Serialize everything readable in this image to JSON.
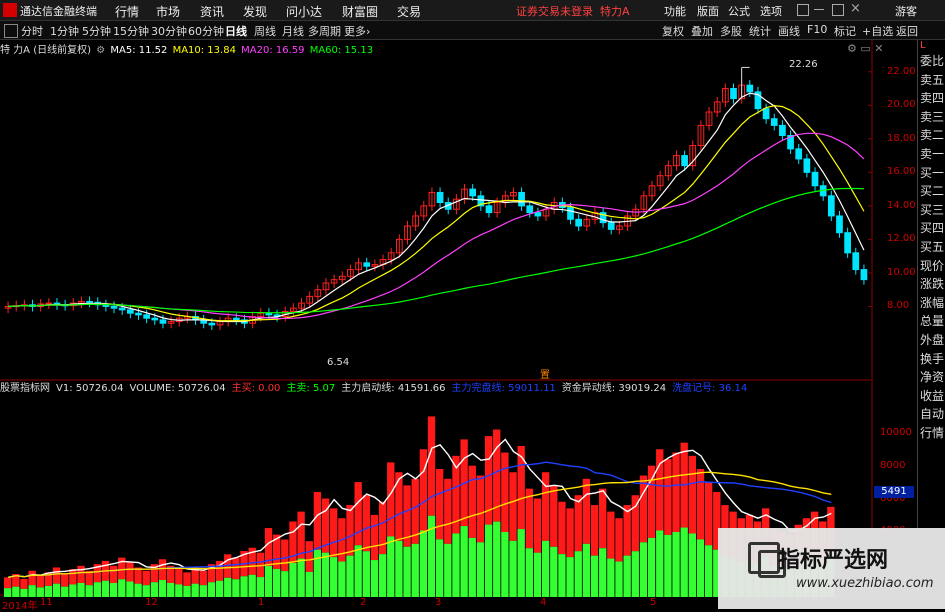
{
  "app": {
    "title": "通达信金融终端",
    "status": "证券交易未登录",
    "stock_header": "特力A"
  },
  "menu": [
    "行情",
    "市场",
    "资讯",
    "发现",
    "问小达",
    "财富圈",
    "交易"
  ],
  "menu_right": [
    "功能",
    "版面",
    "公式",
    "选项",
    "游客"
  ],
  "toolbar": {
    "periods": [
      "分时",
      "1分钟",
      "5分钟",
      "15分钟",
      "30分钟",
      "60分钟",
      "日线",
      "周线",
      "月线",
      "多周期",
      "更多›"
    ],
    "selected": "日线",
    "right": [
      "复权",
      "叠加",
      "多股",
      "统计",
      "画线",
      "F10",
      "标记",
      "+自选",
      "返回"
    ]
  },
  "ma_line": {
    "name": "特 力A (日线前复权)",
    "items": [
      {
        "label": "MA5: 11.52",
        "color": "#ffffff"
      },
      {
        "label": "MA10: 13.84",
        "color": "#ffff00"
      },
      {
        "label": "MA20: 16.59",
        "color": "#ff40ff"
      },
      {
        "label": "MA60: 15.13",
        "color": "#00ff00"
      }
    ]
  },
  "price_axis": [
    "22.00",
    "20.00",
    "18.00",
    "16.00",
    "14.00",
    "12.00",
    "10.00",
    "8.00"
  ],
  "annotations": {
    "high": "22.26",
    "low": "6.54",
    "marker": "置"
  },
  "right_panel": {
    "top_label": "L",
    "items": [
      "委比",
      "卖五",
      "卖四",
      "卖三",
      "卖二",
      "卖一",
      "买一",
      "买二",
      "买三",
      "买四",
      "买五",
      "现价",
      "涨跌",
      "涨幅",
      "总量",
      "外盘",
      "换手",
      "净资",
      "收益",
      "自动",
      "行情"
    ]
  },
  "indicator_line": {
    "items": [
      {
        "label": "股票指标网",
        "color": "#dddddd"
      },
      {
        "label": "V1: 50726.04",
        "color": "#dddddd"
      },
      {
        "label": "VOLUME: 50726.04",
        "color": "#dddddd"
      },
      {
        "label": "主买: 0.00",
        "color": "#ff3030"
      },
      {
        "label": "主卖: 5.07",
        "color": "#00ff00"
      },
      {
        "label": "主力启动线: 41591.66",
        "color": "#dddddd"
      },
      {
        "label": "主力完盘线: 59011.11",
        "color": "#2040ff"
      },
      {
        "label": "资金异动线: 39019.24",
        "color": "#dddddd"
      },
      {
        "label": "洗盘记号: 36.14",
        "color": "#2040ff"
      }
    ]
  },
  "volume_axis": [
    "10000",
    "8000",
    "6000",
    "4000"
  ],
  "volume_current": "5491",
  "time_ticks": [
    "14:5",
    "14:5",
    "14:5",
    "14:5",
    "14:5",
    "14:5",
    "14:5",
    "14:5"
  ],
  "dates": [
    "2014年",
    "11",
    "12",
    "1",
    "2",
    "3",
    "4",
    "5"
  ],
  "watermark": {
    "title": "指标严选网",
    "url": "www.xuezhibiao.com"
  },
  "colors": {
    "up": "#ff2020",
    "down": "#00e5ff",
    "ma5": "#ffffff",
    "ma10": "#ffff00",
    "ma20": "#ff40ff",
    "ma60": "#00ff00"
  },
  "chart_data": {
    "type": "candlestick",
    "title": "特力A (日线前复权)",
    "ylim": [
      6.0,
      23.0
    ],
    "high": 22.26,
    "low": 6.54,
    "closes": [
      8.0,
      8.05,
      8.1,
      8.0,
      8.15,
      8.2,
      8.1,
      8.05,
      8.2,
      8.3,
      8.25,
      8.1,
      8.0,
      7.9,
      7.8,
      7.6,
      7.5,
      7.3,
      7.2,
      7.0,
      7.1,
      7.3,
      7.4,
      7.2,
      7.0,
      6.9,
      7.1,
      7.3,
      7.2,
      7.0,
      7.4,
      7.6,
      7.5,
      7.4,
      7.7,
      7.9,
      8.2,
      8.6,
      9.0,
      9.4,
      9.6,
      9.8,
      10.2,
      10.6,
      10.4,
      10.5,
      10.8,
      11.2,
      12.0,
      12.8,
      13.4,
      14.0,
      14.8,
      14.2,
      13.8,
      14.4,
      15.0,
      14.6,
      14.0,
      13.6,
      14.2,
      14.6,
      14.8,
      14.0,
      13.6,
      13.4,
      13.8,
      14.2,
      13.9,
      13.2,
      12.8,
      13.2,
      13.6,
      13.0,
      12.6,
      12.8,
      13.4,
      13.8,
      14.6,
      15.2,
      15.8,
      16.4,
      17.0,
      16.4,
      17.6,
      18.8,
      19.6,
      20.2,
      21.0,
      20.4,
      21.2,
      20.8,
      19.8,
      19.2,
      18.8,
      18.2,
      17.4,
      16.8,
      16.0,
      15.2,
      14.6,
      13.4,
      12.4,
      11.2,
      10.2,
      9.6
    ],
    "volume_ylim": [
      0,
      12000
    ],
    "volume": [
      1200,
      1400,
      1100,
      1600,
      1300,
      1500,
      1800,
      1400,
      1700,
      1900,
      1600,
      2000,
      2200,
      1900,
      2400,
      2100,
      1800,
      1600,
      2000,
      2300,
      1900,
      1700,
      1500,
      1800,
      1600,
      2000,
      2200,
      2600,
      2400,
      2800,
      3000,
      2700,
      4200,
      3800,
      3500,
      4600,
      5200,
      3400,
      6400,
      6000,
      5400,
      4800,
      5600,
      7000,
      6200,
      5000,
      5800,
      8200,
      7600,
      6800,
      7200,
      9000,
      11000,
      7800,
      7200,
      8600,
      9600,
      8000,
      7400,
      9800,
      10200,
      8800,
      7600,
      9200,
      6600,
      6000,
      7600,
      6800,
      5800,
      5400,
      6200,
      7200,
      5600,
      6600,
      5200,
      4800,
      5600,
      6200,
      7400,
      8000,
      9000,
      8400,
      8800,
      9400,
      8600,
      7800,
      7000,
      6400,
      5600,
      5200,
      4800,
      5000,
      4600,
      5400,
      4200,
      4000,
      3800,
      4400,
      4800,
      5200,
      4600,
      5491
    ]
  }
}
